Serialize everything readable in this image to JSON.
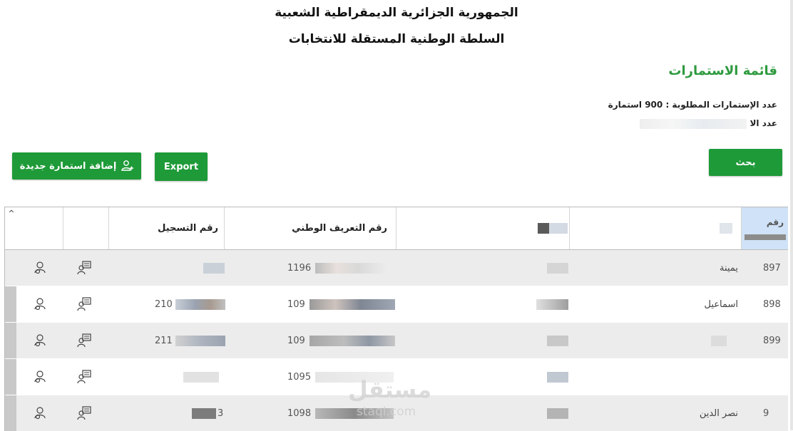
{
  "header": {
    "line1": "الجمهورية الجزائرية الديمقراطية الشعبية",
    "line2": "السلطة الوطنية المستقلة للانتخابات"
  },
  "page_title": "قائمة الاستمارات",
  "stats": {
    "required_label": "عدد الإستمارات المطلوبة : 900 استمارة",
    "second_label": "عدد الا"
  },
  "buttons": {
    "add": "إضافة استمارة جديدة",
    "export": "Export",
    "search": "بحث"
  },
  "table": {
    "columns": {
      "registration": "رقم التسجيل",
      "national_id": "رقم التعريف الوطني",
      "number_partial": "رقم"
    },
    "rows": [
      {
        "number": "897",
        "name": "يمينة",
        "nid_prefix": "1196",
        "reg_prefix": ""
      },
      {
        "number": "898",
        "name": "اسماعيل",
        "nid_prefix": "109",
        "reg_prefix": "210"
      },
      {
        "number": "899",
        "name": "",
        "nid_prefix": "109",
        "reg_prefix": "211"
      },
      {
        "number": "",
        "name": "",
        "nid_prefix": "1095",
        "reg_prefix": ""
      },
      {
        "number": "9",
        "name": "نصر الدين",
        "nid_prefix": "1098",
        "reg_prefix": "3"
      }
    ]
  },
  "watermark": {
    "text": "مستقل",
    "domain": "staql.com"
  },
  "colors": {
    "accent": "#1e9a38",
    "title_green": "#2e9a3e",
    "header_selected": "#cfe2f7"
  },
  "icons": {
    "add_user": "add-user-icon",
    "row_action_1": "user-search-icon",
    "row_action_2": "form-list-icon"
  }
}
